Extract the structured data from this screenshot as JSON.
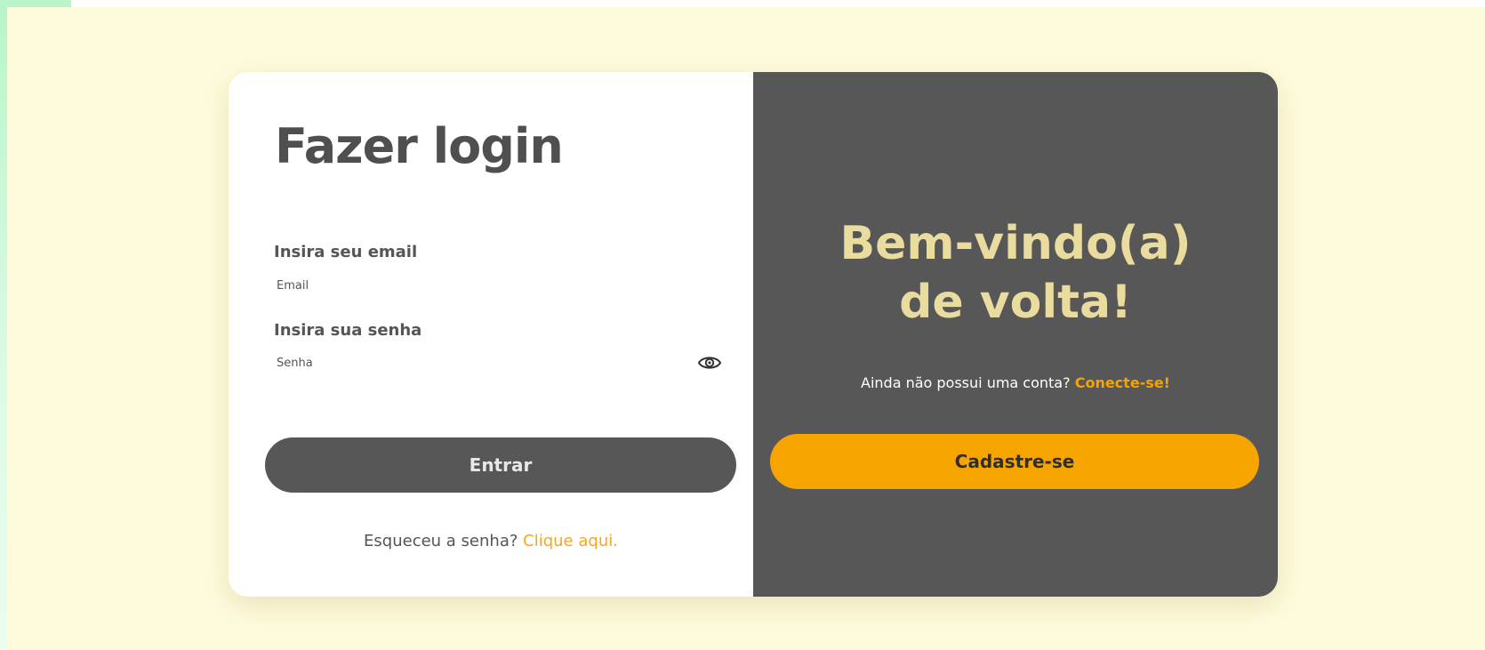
{
  "login": {
    "title": "Fazer login",
    "email_label": "Insira seu email",
    "email_placeholder": "Email",
    "password_label": "Insira sua senha",
    "password_placeholder": "Senha",
    "password_toggle_icon": "eye-icon",
    "submit_label": "Entrar",
    "forgot_text": "Esqueceu a senha?",
    "forgot_link": "Clique aqui."
  },
  "welcome": {
    "title_line1": "Bem-vindo(a)",
    "title_line2": "de volta!",
    "no_account_text": "Ainda não possui uma conta?",
    "connect_link": "Conecte-se!",
    "signup_label": "Cadastre-se"
  },
  "colors": {
    "page_background": "#fefbdc",
    "dark_panel": "#575757",
    "accent_orange": "#f6a500",
    "welcome_title": "#e9dc9e"
  }
}
